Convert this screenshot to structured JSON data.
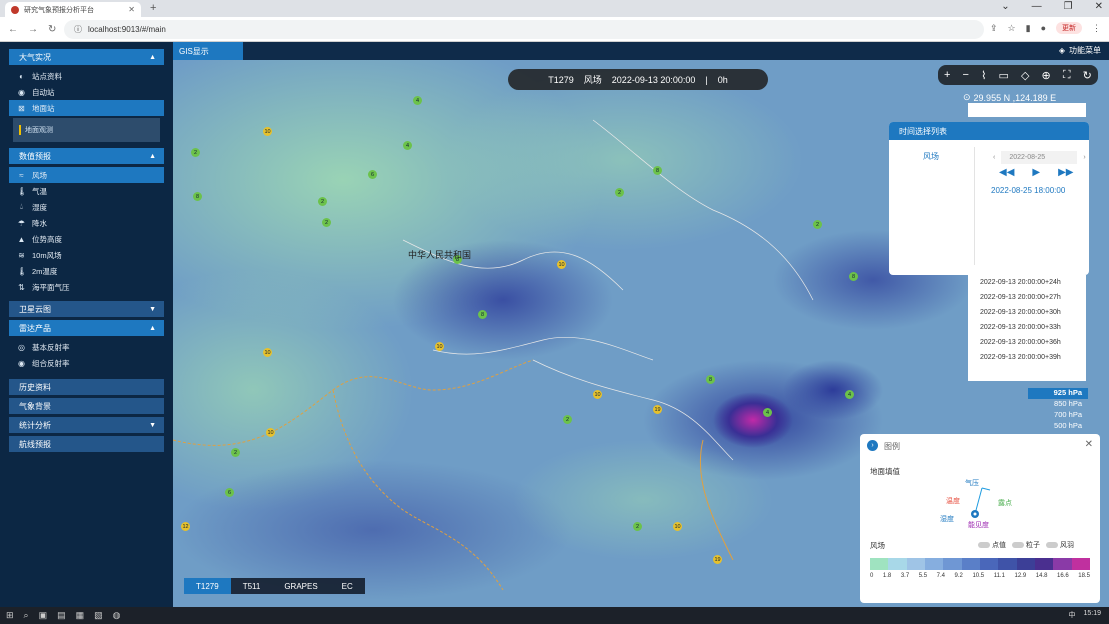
{
  "browser": {
    "tab_title": "研究气象预报分析平台",
    "url": "localhost:9013/#/main",
    "update_label": "更新"
  },
  "sidebar": {
    "sections": [
      {
        "label": "大气实况",
        "items": [
          "站点资料",
          "自动站",
          "地面站"
        ],
        "active": "地面站",
        "sub": "地面观测"
      },
      {
        "label": "数值预报",
        "items": [
          "风场",
          "气温",
          "湿度",
          "降水",
          "位势高度",
          "10m风场",
          "2m温度",
          "海平面气压"
        ],
        "active": "风场"
      },
      {
        "label": "卫星云图"
      },
      {
        "label": "雷达产品",
        "items": [
          "基本反射率",
          "组合反射率"
        ]
      },
      {
        "label": "历史资料"
      },
      {
        "label": "气象背景"
      },
      {
        "label": "统计分析"
      },
      {
        "label": "航线预报"
      }
    ]
  },
  "topbar": {
    "gis_tab": "GIS显示",
    "func_menu": "功能菜单"
  },
  "map": {
    "info": {
      "model": "T1279",
      "var": "风场",
      "time": "2022-09-13 20:00:00",
      "step": "0h"
    },
    "coords": "29.955 N ,124.189 E",
    "region_label": "中华人民共和国"
  },
  "time_panel": {
    "title": "时间选择列表",
    "variable": "风场",
    "date": "2022-08-25",
    "current_time": "2022-08-25 18:00:00",
    "list": [
      "2022-09-13 20:00:00+24h",
      "2022-09-13 20:00:00+27h",
      "2022-09-13 20:00:00+30h",
      "2022-09-13 20:00:00+33h",
      "2022-09-13 20:00:00+36h",
      "2022-09-13 20:00:00+39h"
    ]
  },
  "levels": [
    "925 hPa",
    "850 hPa",
    "700 hPa",
    "500 hPa"
  ],
  "legend": {
    "title": "图例",
    "subtitle": "地面填值",
    "diagram_labels": {
      "pressure": "气压",
      "temperature": "温度",
      "humidity": "湿度",
      "dewpoint": "露点",
      "visibility": "能见度"
    },
    "field": "风场",
    "toggles": [
      "点值",
      "粒子",
      "风羽"
    ],
    "ticks": [
      "0",
      "1.8",
      "3.7",
      "5.5",
      "7.4",
      "9.2",
      "10.5",
      "11.1",
      "12.9",
      "14.8",
      "16.6",
      "18.5"
    ],
    "colors": [
      "#9fe3c0",
      "#a8d8e8",
      "#9fc4e6",
      "#86aedf",
      "#6f97d4",
      "#5a7fc8",
      "#4a67ba",
      "#3f53a8",
      "#3c3f97",
      "#4a2f8f",
      "#8a3aa7",
      "#c0309f"
    ]
  },
  "models": [
    "T1279",
    "T511",
    "GRAPES",
    "EC"
  ],
  "taskbar": {
    "time": "15:19",
    "lang": "中"
  }
}
